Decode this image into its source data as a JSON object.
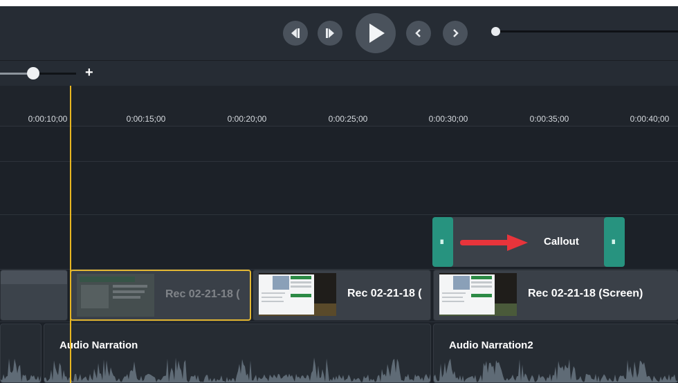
{
  "playback": {
    "buttons": [
      "step-back",
      "step-forward",
      "play",
      "previous",
      "next"
    ],
    "scrub_position": 0
  },
  "zoom": {
    "plus_label": "+",
    "level": 0.44
  },
  "ruler": {
    "tick_labels": [
      "0:00:10;00",
      "0:00:15;00",
      "0:00:20;00",
      "0:00:25;00",
      "0:00:30;00",
      "0:00:35;00",
      "0:00:40;00"
    ]
  },
  "tracks": {
    "callout": {
      "label": "Callout",
      "handle_grip": "III",
      "arrow_color": "#e8343b",
      "handle_color": "#27937f"
    },
    "video_clips": [
      {
        "label": "",
        "selected": false
      },
      {
        "label": "Rec 02-21-18 (",
        "selected": true
      },
      {
        "label": "Rec 02-21-18 (",
        "selected": false
      },
      {
        "label": "Rec 02-21-18 (Screen)",
        "selected": false
      }
    ],
    "audio_clips": [
      {
        "label": ""
      },
      {
        "label": "Audio Narration"
      },
      {
        "label": "Audio Narration2"
      }
    ]
  },
  "colors": {
    "playhead": "#e8b620",
    "selection": "#e3b733",
    "background": "#1c2128"
  }
}
